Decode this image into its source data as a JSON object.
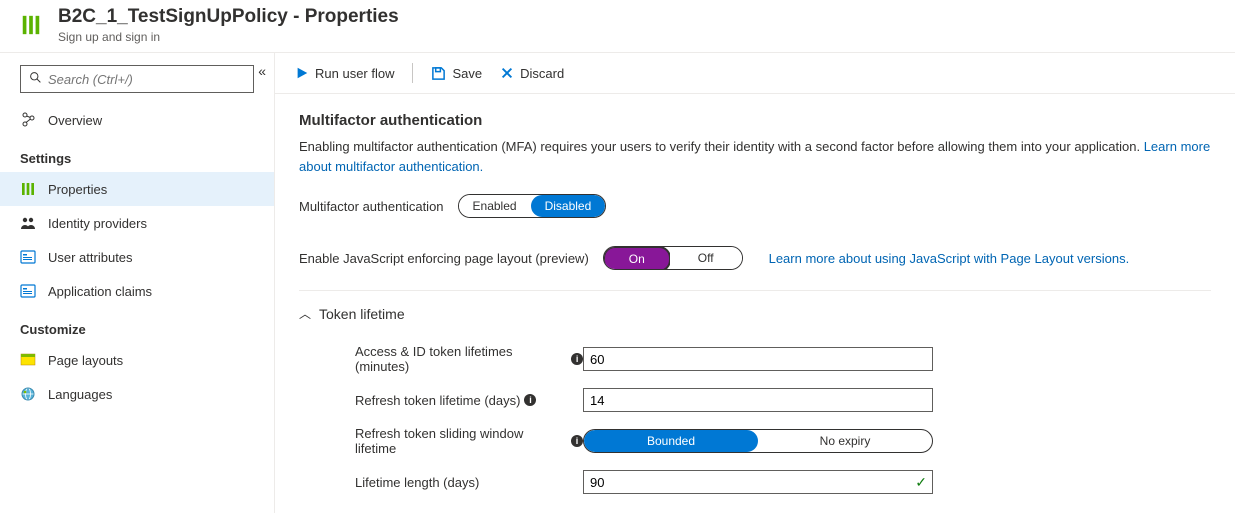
{
  "header": {
    "title": "B2C_1_TestSignUpPolicy - Properties",
    "subtitle": "Sign up and sign in"
  },
  "sidebar": {
    "search_placeholder": "Search (Ctrl+/)",
    "top": [
      {
        "name": "overview",
        "label": "Overview"
      }
    ],
    "group_settings": "Settings",
    "settings": [
      {
        "name": "properties",
        "label": "Properties",
        "selected": true
      },
      {
        "name": "identity-providers",
        "label": "Identity providers"
      },
      {
        "name": "user-attributes",
        "label": "User attributes"
      },
      {
        "name": "application-claims",
        "label": "Application claims"
      }
    ],
    "group_customize": "Customize",
    "customize": [
      {
        "name": "page-layouts",
        "label": "Page layouts"
      },
      {
        "name": "languages",
        "label": "Languages"
      }
    ]
  },
  "toolbar": {
    "run": "Run user flow",
    "save": "Save",
    "discard": "Discard"
  },
  "mfa": {
    "heading": "Multifactor authentication",
    "desc_pre": "Enabling multifactor authentication (MFA) requires your users to verify their identity with a second factor before allowing them into your application. ",
    "link": "Learn more about multifactor authentication.",
    "toggle_label": "Multifactor authentication",
    "opt_enabled": "Enabled",
    "opt_disabled": "Disabled"
  },
  "js": {
    "label": "Enable JavaScript enforcing page layout (preview)",
    "opt_on": "On",
    "opt_off": "Off",
    "link": "Learn more about using JavaScript with Page Layout versions."
  },
  "token": {
    "section": "Token lifetime",
    "access_label": "Access & ID token lifetimes (minutes)",
    "access_value": "60",
    "refresh_label": "Refresh token lifetime (days)",
    "refresh_value": "14",
    "sliding_label": "Refresh token sliding window lifetime",
    "opt_bounded": "Bounded",
    "opt_noexpiry": "No expiry",
    "lifetime_label": "Lifetime length (days)",
    "lifetime_value": "90"
  }
}
